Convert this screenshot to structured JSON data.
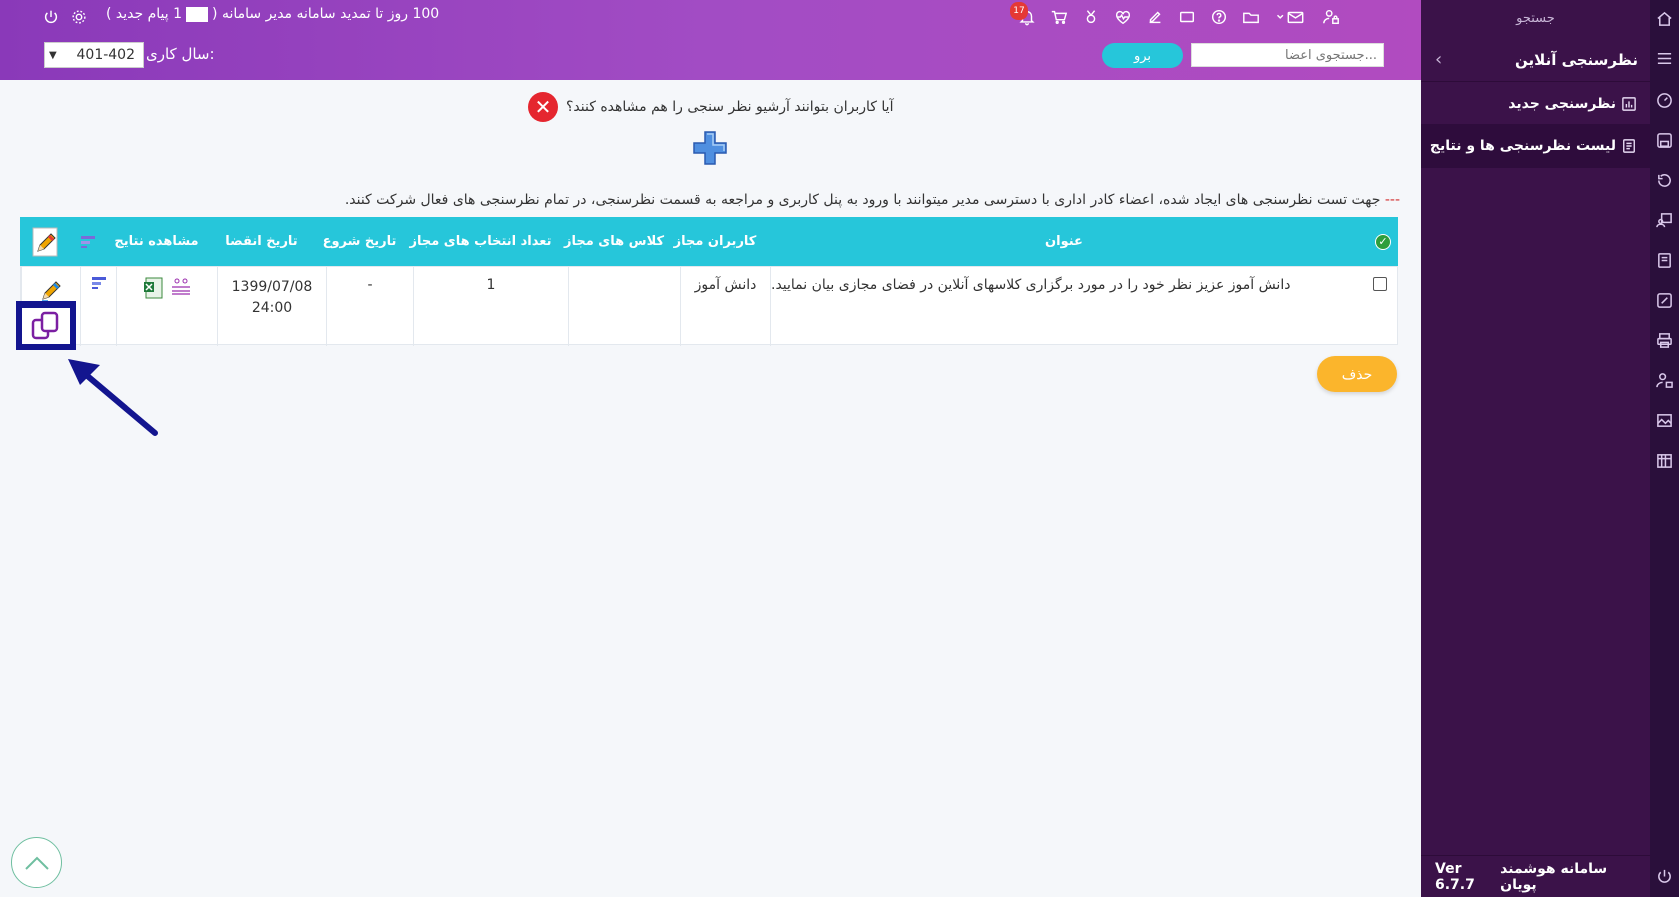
{
  "sidebar": {
    "search_label": "جستجو",
    "header_title": "نظرسنجی آنلاین",
    "items": [
      {
        "label": "نظرسنجی جدید",
        "icon": "chart-icon"
      },
      {
        "label": "لیست نظرسنجی ها و نتایج",
        "icon": "list-icon"
      }
    ],
    "footer_brand": "سامانه هوشمند پویان",
    "footer_version": "Ver 6.7.7"
  },
  "topbar": {
    "renewal_text": "100 روز تا تمدید سامانه مدیر سامانه (",
    "new_message_text": "1 پیام جدید )",
    "notification_count": "17",
    "year_label": "سال کاری:",
    "year_value": "401-402",
    "go_label": "برو",
    "search_placeholder": "جستجوی اعضا..."
  },
  "content": {
    "archive_question": "آیا کاربران بتوانند آرشیو نظر سنجی را هم مشاهده کنند؟",
    "note_dash": "---",
    "note_text": " جهت تست نظرسنجی های ایجاد شده، اعضاء کادر اداری با دسترسی مدیر میتوانند با ورود به پنل کاربری و مراجعه به قسمت نظرسنجی، در تمام نظرسنجی های فعال شرکت کنند."
  },
  "table": {
    "headers": {
      "title": "عنوان",
      "allowed_users": "کاربران مجاز",
      "allowed_classes": "کلاس های مجاز",
      "allowed_choices": "تعداد انتخاب های مجاز",
      "start_date": "تاریخ شروع",
      "end_date": "تاریخ انقضا",
      "view_results": "مشاهده نتایج"
    },
    "rows": [
      {
        "title": "دانش آموز عزیز نظر خود را در مورد برگزاری کلاسهای آنلاین در فضای مجازی بیان نمایید.",
        "allowed_users": "دانش آموز",
        "allowed_classes": "",
        "allowed_choices": "1",
        "start_date": "-",
        "end_date_line1": "1399/07/08",
        "end_date_line2": "24:00"
      }
    ]
  },
  "delete_label": "حذف",
  "colors": {
    "header_gradient_start": "#8a39b9",
    "header_gradient_end": "#b14bc0",
    "sidebar_bg": "#3b1249",
    "table_header_bg": "#26c6da",
    "delete_button_bg": "#fbb52c",
    "expiry_text": "#e01a1a",
    "highlight_box": "#13158f"
  }
}
